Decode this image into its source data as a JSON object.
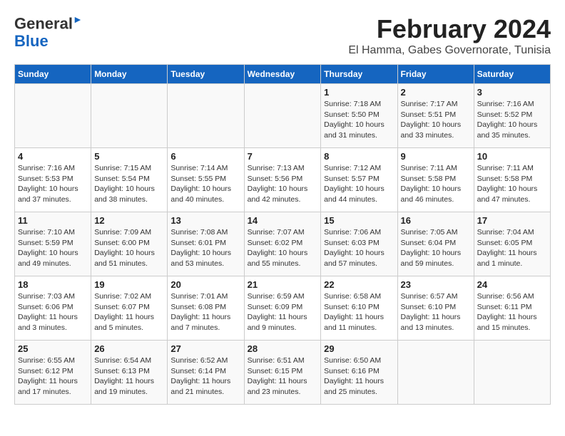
{
  "header": {
    "logo_line1": "General",
    "logo_line2": "Blue",
    "month": "February 2024",
    "location": "El Hamma, Gabes Governorate, Tunisia"
  },
  "days_of_week": [
    "Sunday",
    "Monday",
    "Tuesday",
    "Wednesday",
    "Thursday",
    "Friday",
    "Saturday"
  ],
  "weeks": [
    [
      {
        "day": "",
        "info": ""
      },
      {
        "day": "",
        "info": ""
      },
      {
        "day": "",
        "info": ""
      },
      {
        "day": "",
        "info": ""
      },
      {
        "day": "1",
        "info": "Sunrise: 7:18 AM\nSunset: 5:50 PM\nDaylight: 10 hours and 31 minutes."
      },
      {
        "day": "2",
        "info": "Sunrise: 7:17 AM\nSunset: 5:51 PM\nDaylight: 10 hours and 33 minutes."
      },
      {
        "day": "3",
        "info": "Sunrise: 7:16 AM\nSunset: 5:52 PM\nDaylight: 10 hours and 35 minutes."
      }
    ],
    [
      {
        "day": "4",
        "info": "Sunrise: 7:16 AM\nSunset: 5:53 PM\nDaylight: 10 hours and 37 minutes."
      },
      {
        "day": "5",
        "info": "Sunrise: 7:15 AM\nSunset: 5:54 PM\nDaylight: 10 hours and 38 minutes."
      },
      {
        "day": "6",
        "info": "Sunrise: 7:14 AM\nSunset: 5:55 PM\nDaylight: 10 hours and 40 minutes."
      },
      {
        "day": "7",
        "info": "Sunrise: 7:13 AM\nSunset: 5:56 PM\nDaylight: 10 hours and 42 minutes."
      },
      {
        "day": "8",
        "info": "Sunrise: 7:12 AM\nSunset: 5:57 PM\nDaylight: 10 hours and 44 minutes."
      },
      {
        "day": "9",
        "info": "Sunrise: 7:11 AM\nSunset: 5:58 PM\nDaylight: 10 hours and 46 minutes."
      },
      {
        "day": "10",
        "info": "Sunrise: 7:11 AM\nSunset: 5:58 PM\nDaylight: 10 hours and 47 minutes."
      }
    ],
    [
      {
        "day": "11",
        "info": "Sunrise: 7:10 AM\nSunset: 5:59 PM\nDaylight: 10 hours and 49 minutes."
      },
      {
        "day": "12",
        "info": "Sunrise: 7:09 AM\nSunset: 6:00 PM\nDaylight: 10 hours and 51 minutes."
      },
      {
        "day": "13",
        "info": "Sunrise: 7:08 AM\nSunset: 6:01 PM\nDaylight: 10 hours and 53 minutes."
      },
      {
        "day": "14",
        "info": "Sunrise: 7:07 AM\nSunset: 6:02 PM\nDaylight: 10 hours and 55 minutes."
      },
      {
        "day": "15",
        "info": "Sunrise: 7:06 AM\nSunset: 6:03 PM\nDaylight: 10 hours and 57 minutes."
      },
      {
        "day": "16",
        "info": "Sunrise: 7:05 AM\nSunset: 6:04 PM\nDaylight: 10 hours and 59 minutes."
      },
      {
        "day": "17",
        "info": "Sunrise: 7:04 AM\nSunset: 6:05 PM\nDaylight: 11 hours and 1 minute."
      }
    ],
    [
      {
        "day": "18",
        "info": "Sunrise: 7:03 AM\nSunset: 6:06 PM\nDaylight: 11 hours and 3 minutes."
      },
      {
        "day": "19",
        "info": "Sunrise: 7:02 AM\nSunset: 6:07 PM\nDaylight: 11 hours and 5 minutes."
      },
      {
        "day": "20",
        "info": "Sunrise: 7:01 AM\nSunset: 6:08 PM\nDaylight: 11 hours and 7 minutes."
      },
      {
        "day": "21",
        "info": "Sunrise: 6:59 AM\nSunset: 6:09 PM\nDaylight: 11 hours and 9 minutes."
      },
      {
        "day": "22",
        "info": "Sunrise: 6:58 AM\nSunset: 6:10 PM\nDaylight: 11 hours and 11 minutes."
      },
      {
        "day": "23",
        "info": "Sunrise: 6:57 AM\nSunset: 6:10 PM\nDaylight: 11 hours and 13 minutes."
      },
      {
        "day": "24",
        "info": "Sunrise: 6:56 AM\nSunset: 6:11 PM\nDaylight: 11 hours and 15 minutes."
      }
    ],
    [
      {
        "day": "25",
        "info": "Sunrise: 6:55 AM\nSunset: 6:12 PM\nDaylight: 11 hours and 17 minutes."
      },
      {
        "day": "26",
        "info": "Sunrise: 6:54 AM\nSunset: 6:13 PM\nDaylight: 11 hours and 19 minutes."
      },
      {
        "day": "27",
        "info": "Sunrise: 6:52 AM\nSunset: 6:14 PM\nDaylight: 11 hours and 21 minutes."
      },
      {
        "day": "28",
        "info": "Sunrise: 6:51 AM\nSunset: 6:15 PM\nDaylight: 11 hours and 23 minutes."
      },
      {
        "day": "29",
        "info": "Sunrise: 6:50 AM\nSunset: 6:16 PM\nDaylight: 11 hours and 25 minutes."
      },
      {
        "day": "",
        "info": ""
      },
      {
        "day": "",
        "info": ""
      }
    ]
  ]
}
